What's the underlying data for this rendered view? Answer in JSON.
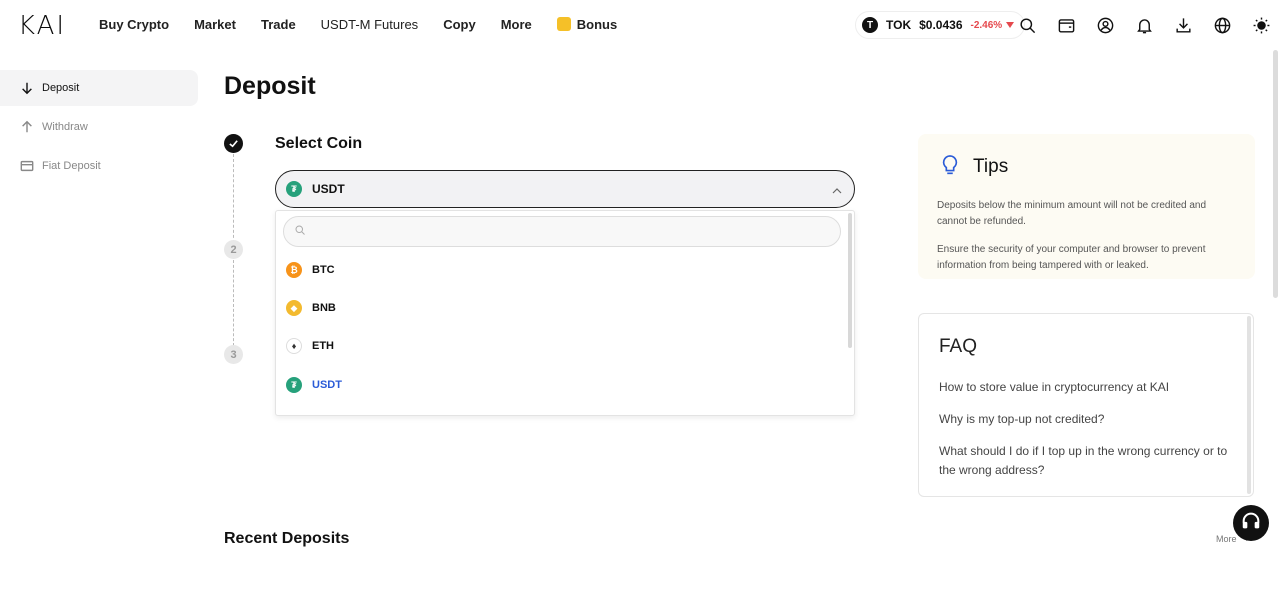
{
  "header": {
    "logo": "KAI",
    "nav": [
      {
        "label": "Buy Crypto",
        "light": false
      },
      {
        "label": "Market",
        "light": false
      },
      {
        "label": "Trade",
        "light": false
      },
      {
        "label": "USDT-M Futures",
        "light": true
      },
      {
        "label": "Copy",
        "light": false
      },
      {
        "label": "More",
        "light": false
      }
    ],
    "bonus_label": "Bonus",
    "ticker": {
      "symbol": "TOK",
      "price": "$0.0436",
      "change": "-2.46%",
      "icon_letter": "T"
    },
    "icons": [
      "search-icon",
      "wallet-icon",
      "account-icon",
      "bell-icon",
      "download-icon",
      "globe-icon",
      "theme-sun-icon"
    ]
  },
  "sidebar": {
    "items": [
      {
        "label": "Deposit",
        "icon": "arrow-down-icon",
        "active": true
      },
      {
        "label": "Withdraw",
        "icon": "arrow-up-icon",
        "active": false
      },
      {
        "label": "Fiat Deposit",
        "icon": "card-icon",
        "active": false
      }
    ]
  },
  "main": {
    "title": "Deposit",
    "steps": [
      "2",
      "3"
    ],
    "select_coin_title": "Select Coin",
    "selected_coin": "USDT",
    "search_placeholder": "",
    "coins": [
      {
        "symbol": "BTC",
        "icon": "btc-icon"
      },
      {
        "symbol": "BNB",
        "icon": "bnb-icon"
      },
      {
        "symbol": "ETH",
        "icon": "eth-icon"
      },
      {
        "symbol": "USDT",
        "icon": "usdt-icon",
        "selected": true
      }
    ],
    "recent_title": "Recent Deposits",
    "more_label": "More"
  },
  "tips": {
    "title": "Tips",
    "items": [
      "Deposits below the minimum amount will not be credited and cannot be refunded.",
      "Ensure the security of your computer and browser to prevent information from being tampered with or leaked."
    ]
  },
  "faq": {
    "title": "FAQ",
    "items": [
      "How to store value in cryptocurrency at KAI",
      "Why is my top-up not credited?",
      "What should I do if I top up in the wrong currency or to the wrong address?"
    ]
  },
  "colors": {
    "accent_blue": "#2a5bd7",
    "negative": "#e5484d",
    "usdt": "#26a17b",
    "btc": "#f7931a",
    "bnb": "#f3ba2f"
  }
}
